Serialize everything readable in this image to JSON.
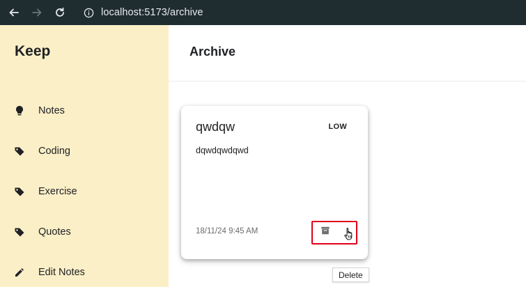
{
  "browser": {
    "url": "localhost:5173/archive"
  },
  "sidebar": {
    "brand": "Keep",
    "items": [
      {
        "label": "Notes",
        "icon": "lightbulb-icon"
      },
      {
        "label": "Coding",
        "icon": "label-icon"
      },
      {
        "label": "Exercise",
        "icon": "label-icon"
      },
      {
        "label": "Quotes",
        "icon": "label-icon"
      },
      {
        "label": "Edit Notes",
        "icon": "pencil-icon"
      }
    ]
  },
  "main": {
    "title": "Archive",
    "note": {
      "title": "qwdqw",
      "priority": "LOW",
      "body": "dqwdqwdqwd",
      "date": "18/11/24 9:45 AM",
      "archive_icon": "archive-icon"
    },
    "tooltip": "Delete"
  },
  "colors": {
    "sidebar_bg": "#fbefc8",
    "chrome_bg": "#1f2d31",
    "highlight": "#e0001b"
  }
}
